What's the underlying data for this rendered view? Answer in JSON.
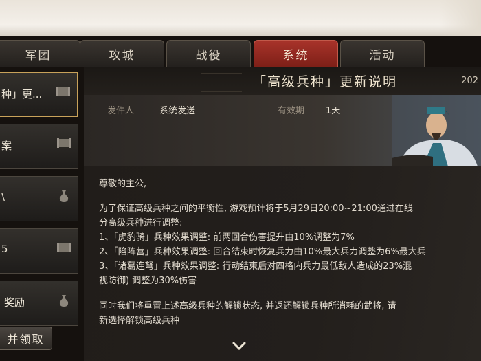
{
  "tabs": [
    {
      "label": "军团",
      "active": false
    },
    {
      "label": "攻城",
      "active": false
    },
    {
      "label": "战役",
      "active": false
    },
    {
      "label": "系统",
      "active": true
    },
    {
      "label": "活动",
      "active": false
    }
  ],
  "sidebar": {
    "items": [
      {
        "label": "种」更...",
        "icon": "scroll-icon"
      },
      {
        "label": "案",
        "icon": "scroll-icon"
      },
      {
        "label": "\\",
        "icon": "bag-icon"
      },
      {
        "label": "5",
        "icon": "scroll-icon"
      },
      {
        "label": "奖励",
        "icon": "bag-icon"
      }
    ],
    "claim_label": "并领取"
  },
  "mail": {
    "title": "「高级兵种」更新说明",
    "date": "202",
    "sender_label": "发件人",
    "sender_value": "系统发送",
    "expiry_label": "有效期",
    "expiry_value": "1天",
    "lines": [
      "尊敬的主公,",
      "",
      "为了保证高级兵种之间的平衡性, 游戏预计将于5月29日20:00~21:00通过在线",
      "分高级兵种进行调整:",
      "1、「虎豹骑」兵种效果调整: 前两回合伤害提升由10%调整为7%",
      "2、「陷阵营」兵种效果调整: 回合结束时恢复兵力由10%最大兵力调整为6%最大兵",
      "3、「诸葛连弩」兵种效果调整: 行动结束后对四格内兵力最低敌人造成的23%混",
      "视防御) 调整为30%伤害",
      "",
      "同时我们将重置上述高级兵种的解锁状态, 并返还解锁兵种所消耗的武将, 请",
      "新选择解锁高级兵种"
    ]
  },
  "colors": {
    "active_tab": "#a8332a",
    "selected_border": "#c8a25a"
  }
}
